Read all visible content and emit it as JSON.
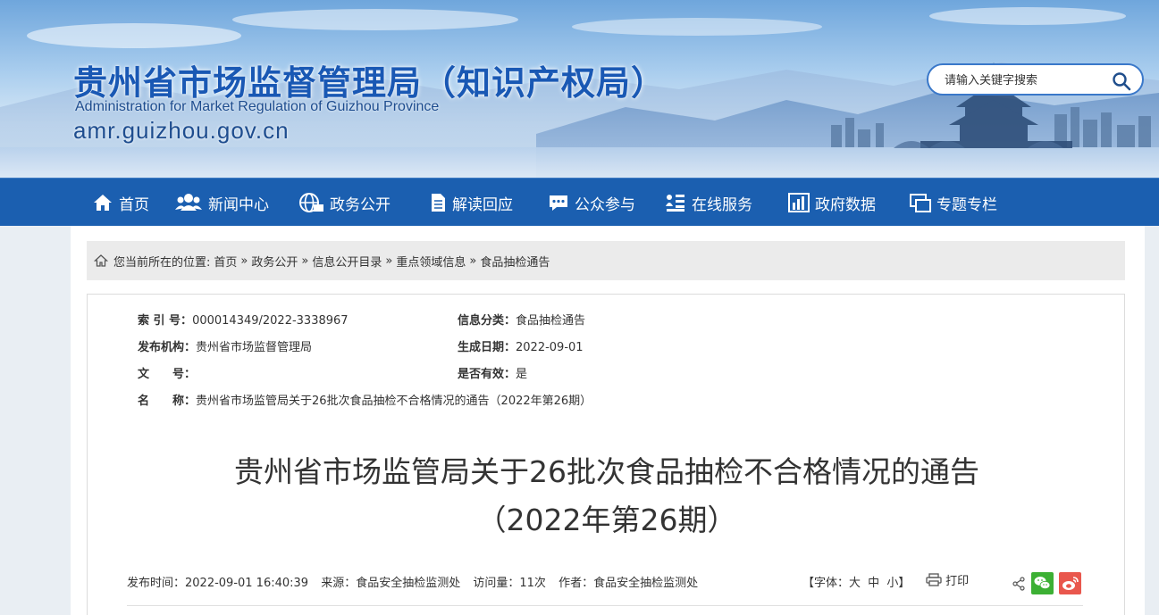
{
  "header": {
    "title": "贵州省市场监督管理局（知识产权局）",
    "subtitle": "Administration for Market Regulation of Guizhou Province",
    "domain": "amr.guizhou.gov.cn",
    "search": {
      "placeholder": "请输入关键字搜索",
      "icon": "search-icon"
    }
  },
  "nav": {
    "items": [
      {
        "label": "首页",
        "icon": "home-icon"
      },
      {
        "label": "新闻中心",
        "icon": "users-icon"
      },
      {
        "label": "政务公开",
        "icon": "globe-icon"
      },
      {
        "label": "解读回应",
        "icon": "document-icon"
      },
      {
        "label": "公众参与",
        "icon": "chat-icon"
      },
      {
        "label": "在线服务",
        "icon": "list-icon"
      },
      {
        "label": "政府数据",
        "icon": "bar-chart-icon"
      },
      {
        "label": "专题专栏",
        "icon": "window-icon"
      }
    ]
  },
  "breadcrumb": {
    "prefix": "您当前所在的位置:",
    "items": [
      "首页",
      "政务公开",
      "信息公开目录",
      "重点领域信息",
      "食品抽检通告"
    ],
    "separator": "»"
  },
  "meta": {
    "index_label": "索 引 号：",
    "index_value": "000014349/2022-3338967",
    "category_label": "信息分类：",
    "category_value": "食品抽检通告",
    "publisher_label": "发布机构：",
    "publisher_value": "贵州省市场监督管理局",
    "date_label": "生成日期：",
    "date_value": "2022-09-01",
    "doc_label": "文　　号：",
    "doc_value": "",
    "valid_label": "是否有效：",
    "valid_value": "是",
    "name_label": "名　　称：",
    "name_value": "贵州省市场监管局关于26批次食品抽检不合格情况的通告（2022年第26期）"
  },
  "article": {
    "title_line1": "贵州省市场监管局关于26批次食品抽检不合格情况的通告",
    "title_line2": "（2022年第26期）"
  },
  "info": {
    "publish_time": "发布时间：2022-09-01 16:40:39",
    "source": "来源：食品安全抽检监测处",
    "visits": "访问量：11次",
    "author": "作者：食品安全抽检监测处",
    "font_prefix": "【字体：",
    "font_large": "大",
    "font_medium": "中",
    "font_small": "小",
    "font_suffix": "】",
    "print": "打印"
  },
  "colors": {
    "nav_bg": "#1b5fb0",
    "title_blue": "#1958b4",
    "wechat": "#3cb034",
    "weibo": "#e9574d"
  }
}
